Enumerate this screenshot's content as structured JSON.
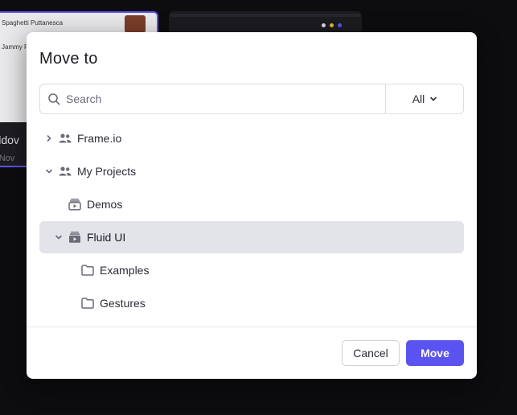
{
  "background": {
    "card1": {
      "lines": [
        "Spaghetti Puttanesca",
        "Jammy P"
      ],
      "title": "illdov",
      "meta": "· Nov"
    }
  },
  "modal": {
    "title": "Move to",
    "search": {
      "placeholder": "Search",
      "value": ""
    },
    "filter": {
      "selected": "All"
    },
    "tree": [
      {
        "label": "Frame.io",
        "icon": "team-icon",
        "expanded": false,
        "selected": false
      },
      {
        "label": "My Projects",
        "icon": "team-icon",
        "expanded": true,
        "selected": false
      },
      {
        "label": "Demos",
        "icon": "project-icon",
        "expanded": false,
        "selected": false
      },
      {
        "label": "Fluid UI",
        "icon": "project-icon",
        "expanded": true,
        "selected": true
      },
      {
        "label": "Examples",
        "icon": "folder-icon",
        "expanded": false,
        "selected": false
      },
      {
        "label": "Gestures",
        "icon": "folder-icon",
        "expanded": false,
        "selected": false
      }
    ],
    "buttons": {
      "cancel": "Cancel",
      "move": "Move"
    }
  },
  "colors": {
    "accent": "#5b53f0",
    "selected_row": "#e3e4ea",
    "icon": "#6b6c78",
    "text": "#2b2c36"
  }
}
